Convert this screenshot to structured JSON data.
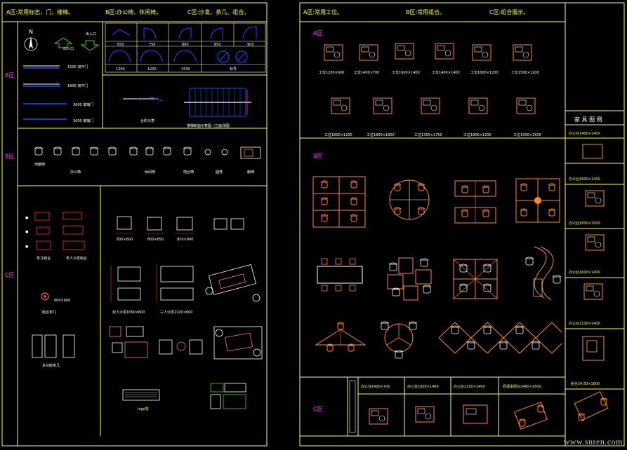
{
  "colors": {
    "background": "#000000",
    "frame": "#ffff3a",
    "text": "#ffffff",
    "zone_letter": "#ff3aff",
    "furniture": "#ff8a20",
    "door": "#1a4dff",
    "stairs": "#1a4dff",
    "accent_red": "#ff3030",
    "accent_green": "#3ad13a"
  },
  "left_sheet": {
    "headers": {
      "a": "A区:常用标志、门、楼梯。",
      "b": "B区:办公椅、休闲椅。",
      "c": "C区:沙发、茶几、组合。"
    },
    "zone_letters": [
      "A区",
      "B区",
      "C区"
    ],
    "zone_a": {
      "compass_label": "N",
      "arrow_labels": [
        "出入口",
        "出入口"
      ],
      "door_plan_labels": [
        "1500 双开门",
        "1800 双开门",
        "3600 玻璃门",
        "3000 玻璃门"
      ],
      "door_swing_top": [
        "650",
        "750",
        "800",
        "850",
        "900"
      ],
      "door_swing_bottom": [
        "1200",
        "1200",
        "1500",
        "标号"
      ],
      "stair_labels": [
        "台阶示意",
        "楼梯断面示意图（立面详图）"
      ]
    },
    "zone_b": {
      "chair_labels": [
        "电脑椅",
        "办公椅",
        "休闲椅",
        "吧台椅",
        "圆凳",
        "躺椅"
      ]
    },
    "zone_c": {
      "table_labels": [
        "茶几组合",
        "单人沙发组合",
        "600×600",
        "组合茶几",
        "多功能茶几"
      ],
      "sofa_sizes": [
        "800×800",
        "800×850",
        "850×900"
      ],
      "sofa_labels": [
        "双人沙发1650×800",
        "三人沙发2100×800"
      ],
      "logo_label": "logo墙"
    }
  },
  "right_sheet": {
    "headers": {
      "a": "A区:常用工位。",
      "b": "B区:常用组合。",
      "c": "C区:组合展示。"
    },
    "zone_letters": [
      "A区",
      "B区",
      "C区"
    ],
    "zone_a_row1": [
      "工位1200×600",
      "工位1400×700",
      "工位1600×1400",
      "工位1400×1400",
      "工位1600×1200",
      "工位1500×1200"
    ],
    "zone_a_row2": [
      "工位1800×1200",
      "工位1800×1800",
      "工位1350×1750",
      "工位1800×1200",
      "工位1500×1500"
    ],
    "legend_title": "家 具 图 例",
    "legend_items": [
      "办公台1400×1400",
      "办公台1600×1400",
      "办公台1600×1500",
      "办公台1600×1400",
      "办公台2100×1400",
      "组合24.60×1600"
    ],
    "bottom_labels": [
      "办公台1400×700",
      "办公台1600×1400",
      "办公台2100×1400",
      "经理桌组台2460×1600"
    ]
  },
  "watermark": "www.snren.com"
}
